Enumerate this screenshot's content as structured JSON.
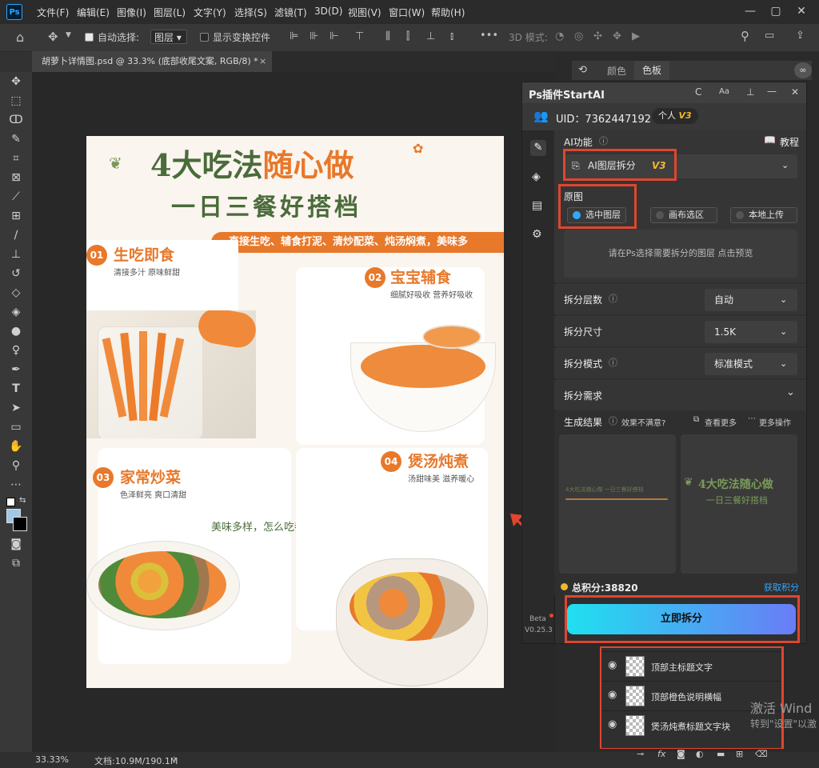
{
  "menubar": {
    "logo": "Ps",
    "items": [
      "文件(F)",
      "编辑(E)",
      "图像(I)",
      "图层(L)",
      "文字(Y)",
      "选择(S)",
      "滤镜(T)",
      "3D(D)",
      "视图(V)",
      "窗口(W)",
      "帮助(H)"
    ]
  },
  "options": {
    "auto_select_label": "自动选择:",
    "auto_select_value": "图层",
    "show_transform_label": "显示变换控件",
    "mode_3d_label": "3D 模式:"
  },
  "tab": {
    "title": "胡萝卜详情图.psd @ 33.3% (底部收尾文案, RGB/8) *"
  },
  "status": {
    "zoom": "33.33%",
    "doc_info": "文档:10.9M/190.1M"
  },
  "swatches": {
    "tab_color": "颜色",
    "tab_swatches": "色板"
  },
  "design": {
    "title_part1": "4大吃法",
    "title_part2": "随心做",
    "subtitle": "一日三餐好搭档",
    "banner": "直接生吃、辅食打泥、清炒配菜、炖汤焖煮，美味多",
    "items": [
      {
        "num": "01",
        "title": "生吃即食",
        "desc": "清接多汁  原味鲜甜"
      },
      {
        "num": "02",
        "title": "宝宝辅食",
        "desc": "细腻好吸收 营养好吸收"
      },
      {
        "num": "03",
        "title": "家常炒菜",
        "desc": "色泽鲜亮  爽口清甜"
      },
      {
        "num": "04",
        "title": "煲汤炖煮",
        "desc": "汤甜味美 滋养暖心"
      }
    ],
    "slogan": "美味多样，怎么吃都好吃！"
  },
  "plugin": {
    "title": "Ps插件StartAI",
    "head_icons": [
      "C",
      "Aa",
      "⊥",
      "—",
      "✕"
    ],
    "uid": "UID：7362447192",
    "account_type": "个人",
    "account_version": "V3",
    "ai_func_label": "AI功能",
    "tutorial_label": "教程",
    "ai_func_value": "AI图层拆分",
    "ai_func_version": "V3",
    "source_label": "原图",
    "source_options": [
      "选中图层",
      "画布选区",
      "本地上传"
    ],
    "source_selected": 0,
    "preview_hint": "请在Ps选择需要拆分的图层 点击预览",
    "split_layers_label": "拆分层数",
    "split_layers_value": "自动",
    "split_size_label": "拆分尺寸",
    "split_size_value": "1.5K",
    "split_mode_label": "拆分模式",
    "split_mode_value": "标准模式",
    "split_need_label": "拆分需求",
    "result_label": "生成结果",
    "unsatisfied_label": "效果不满意?",
    "view_more_label": "查看更多",
    "more_ops_label": "更多操作",
    "result_card1_text": "4大吃法随心做 一日三餐好搭档",
    "result_card2_line1": "4大吃法随心做",
    "result_card2_line2": "一日三餐好搭档",
    "points_label": "总积分:38820",
    "get_points_label": "获取积分",
    "beta_label": "Beta",
    "version": "V0.25.3",
    "split_now_label": "立即拆分"
  },
  "layers": {
    "rows": [
      {
        "name": "顶部主标题文字"
      },
      {
        "name": "顶部橙色说明横幅"
      },
      {
        "name": "煲汤炖煮标题文字块"
      }
    ]
  },
  "watermark": {
    "line1": "激活 Wind",
    "line2": "转到\"设置\"以激"
  },
  "colors": {
    "accent_orange": "#e8782a",
    "plugin_button_gradient": [
      "#1fe0f0",
      "#6a7cf6"
    ],
    "highlight_red": "#e0462f",
    "title_green": "#4a6b3a"
  }
}
